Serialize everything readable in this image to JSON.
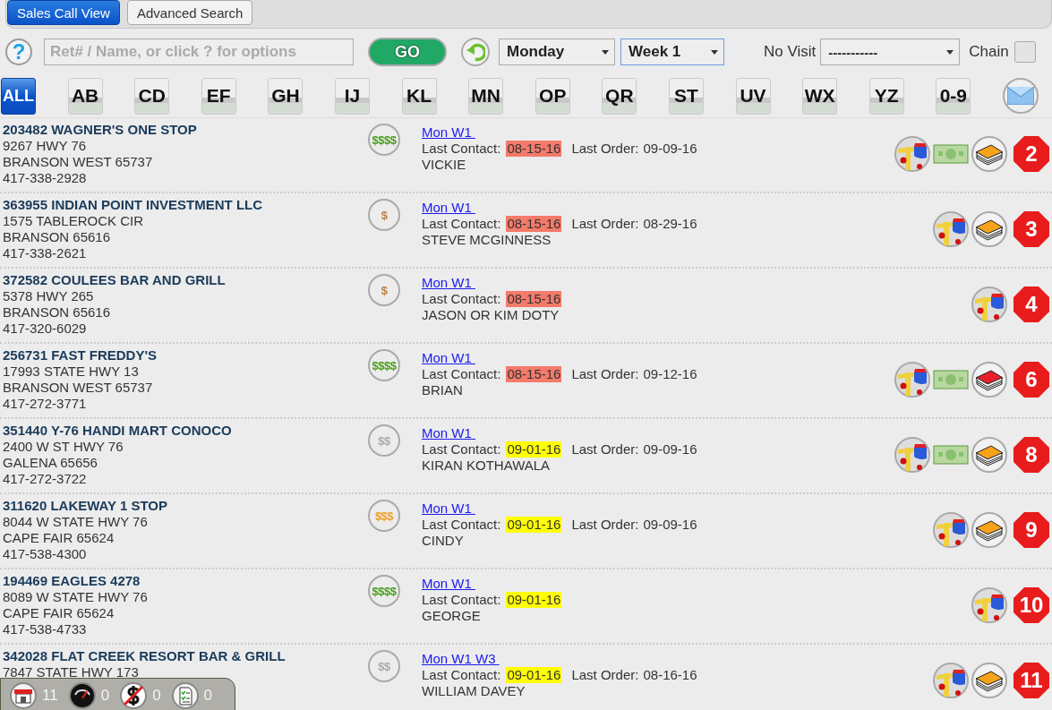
{
  "tabs": [
    {
      "label": "Sales Call View",
      "selected": true
    },
    {
      "label": "Advanced Search",
      "selected": false
    }
  ],
  "toolbar": {
    "help": "?",
    "search": {
      "placeholder": "Ret# / Name, or click ? for options"
    },
    "go": "GO",
    "day": "Monday",
    "week": "Week 1",
    "no_visit_label": "No Visit",
    "no_visit": "-----------",
    "chain_label": "Chain",
    "chain_checked": false
  },
  "letters": [
    {
      "label": "ALL",
      "selected": true
    },
    {
      "label": "AB",
      "selected": false
    },
    {
      "label": "CD",
      "selected": false
    },
    {
      "label": "EF",
      "selected": false
    },
    {
      "label": "GH",
      "selected": false
    },
    {
      "label": "IJ",
      "selected": false
    },
    {
      "label": "KL",
      "selected": false
    },
    {
      "label": "MN",
      "selected": false
    },
    {
      "label": "OP",
      "selected": false
    },
    {
      "label": "QR",
      "selected": false
    },
    {
      "label": "ST",
      "selected": false
    },
    {
      "label": "UV",
      "selected": false
    },
    {
      "label": "WX",
      "selected": false
    },
    {
      "label": "YZ",
      "selected": false
    },
    {
      "label": "0-9",
      "selected": false
    }
  ],
  "rows": [
    {
      "title": "203482 WAGNER'S ONE STOP",
      "address": "9267 HWY 76",
      "city": "BRANSON WEST 65737",
      "phone": "417-338-2928",
      "price": {
        "label": "$$$$",
        "color": "#4aa01c"
      },
      "schedule": "Mon W1 ",
      "contact_label": "Last Contact:",
      "contact": {
        "date": "08-15-16",
        "color": "#f47a6a"
      },
      "order_label": "Last Order:",
      "order": "09-09-16",
      "person": "VICKIE",
      "cash": true,
      "book": {
        "color": "#f7a21b"
      },
      "badge": "2"
    },
    {
      "title": "363955 INDIAN POINT INVESTMENT LLC",
      "address": "1575 TABLEROCK CIR",
      "city": "BRANSON 65616",
      "phone": "417-338-2621",
      "price": {
        "label": "$",
        "color": "#b8804a"
      },
      "schedule": "Mon W1 ",
      "contact_label": "Last Contact:",
      "contact": {
        "date": "08-15-16",
        "color": "#f47a6a"
      },
      "order_label": "Last Order:",
      "order": "08-29-16",
      "person": "STEVE MCGINNESS",
      "cash": false,
      "book": {
        "color": "#f7a21b"
      },
      "badge": "3"
    },
    {
      "title": "372582 COULEES BAR AND GRILL",
      "address": "5378 HWY 265",
      "city": "BRANSON 65616",
      "phone": "417-320-6029",
      "price": {
        "label": "$",
        "color": "#b8804a"
      },
      "schedule": "Mon W1 ",
      "contact_label": "Last Contact:",
      "contact": {
        "date": "08-15-16",
        "color": "#f47a6a"
      },
      "person": "JASON OR KIM DOTY",
      "cash": false,
      "badge": "4"
    },
    {
      "title": "256731 FAST FREDDY'S",
      "address": "17993 STATE HWY 13",
      "city": "BRANSON WEST 65737",
      "phone": "417-272-3771",
      "price": {
        "label": "$$$$",
        "color": "#4aa01c"
      },
      "schedule": "Mon W1 ",
      "contact_label": "Last Contact:",
      "contact": {
        "date": "08-15-16",
        "color": "#f47a6a"
      },
      "order_label": "Last Order:",
      "order": "09-12-16",
      "person": "BRIAN",
      "cash": true,
      "book": {
        "color": "#e8202a"
      },
      "badge": "6"
    },
    {
      "title": "351440 Y-76 HANDI MART CONOCO",
      "address": "2400 W ST HWY 76",
      "city": "GALENA 65656",
      "phone": "417-272-3722",
      "price": {
        "label": "$$",
        "color": "#aaaaaa"
      },
      "schedule": "Mon W1 ",
      "contact_label": "Last Contact:",
      "contact": {
        "date": "09-01-16",
        "color": "#ffff00"
      },
      "order_label": "Last Order:",
      "order": "09-09-16",
      "person": "KIRAN KOTHAWALA",
      "cash": true,
      "book": {
        "color": "#f7a21b"
      },
      "badge": "8"
    },
    {
      "title": "311620 LAKEWAY 1 STOP",
      "address": "8044 W STATE HWY 76",
      "city": "CAPE FAIR 65624",
      "phone": "417-538-4300",
      "price": {
        "label": "$$$",
        "color": "#e8a030"
      },
      "schedule": "Mon W1 ",
      "contact_label": "Last Contact:",
      "contact": {
        "date": "09-01-16",
        "color": "#ffff00"
      },
      "order_label": "Last Order:",
      "order": "09-09-16",
      "person": "CINDY",
      "cash": false,
      "book": {
        "color": "#f7a21b"
      },
      "badge": "9"
    },
    {
      "title": "194469 EAGLES 4278",
      "address": "8089 W STATE HWY 76",
      "city": "CAPE FAIR 65624",
      "phone": "417-538-4733",
      "price": {
        "label": "$$$$",
        "color": "#4aa01c"
      },
      "schedule": "Mon W1 ",
      "contact_label": "Last Contact:",
      "contact": {
        "date": "09-01-16",
        "color": "#ffff00"
      },
      "person": "GEORGE",
      "cash": false,
      "badge": "10"
    },
    {
      "title": "342028 FLAT CREEK RESORT BAR & GRILL",
      "address": "7847 STATE HWY 173",
      "price": {
        "label": "$$",
        "color": "#aaaaaa"
      },
      "schedule": "Mon W1 W3 ",
      "contact_label": "Last Contact:",
      "contact": {
        "date": "09-01-16",
        "color": "#ffff00"
      },
      "order_label": "Last Order:",
      "order": "08-16-16",
      "person": "WILLIAM DAVEY",
      "cash": false,
      "book": {
        "color": "#f7a21b"
      },
      "badge": "11"
    }
  ],
  "footer": [
    {
      "kind": "store",
      "count": "11"
    },
    {
      "kind": "gauge",
      "count": "0"
    },
    {
      "kind": "nodollar",
      "count": "0"
    },
    {
      "kind": "checklist",
      "count": "0"
    }
  ]
}
